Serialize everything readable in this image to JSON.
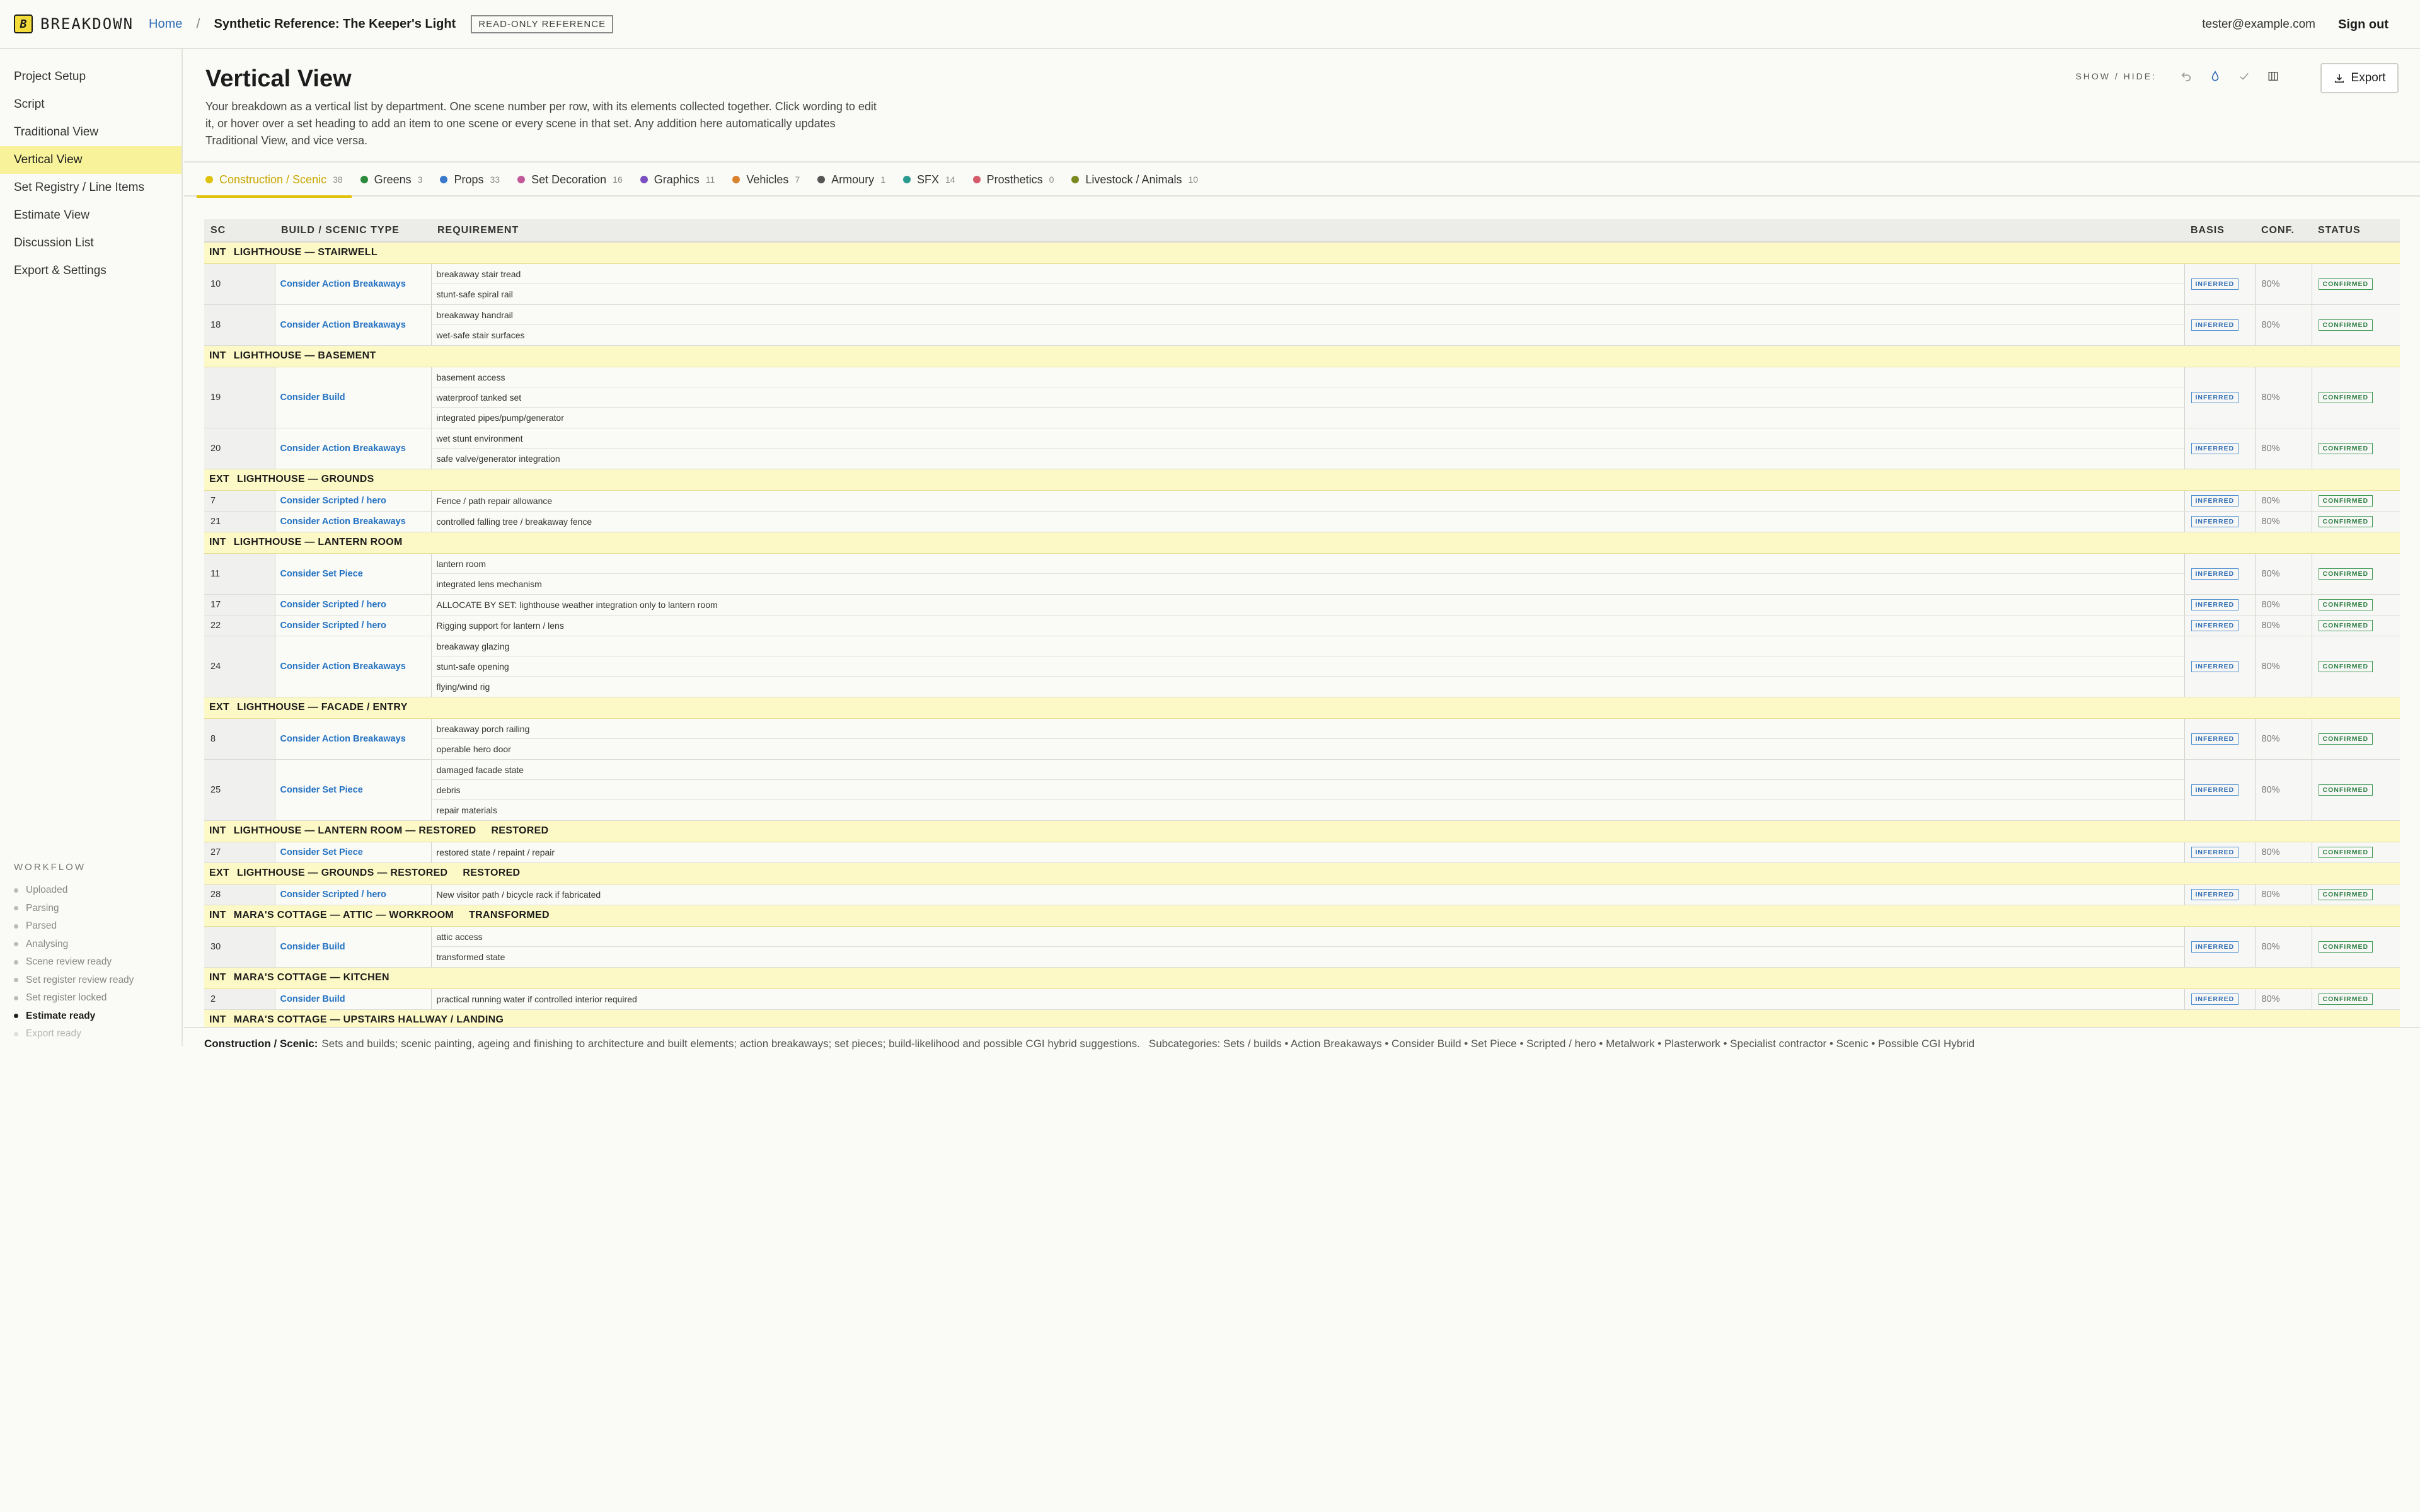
{
  "topbar": {
    "logo_mark": "B",
    "logo_text": "BREAKDOWN",
    "home": "Home",
    "separator": "/",
    "project_title": "Synthetic Reference: The Keeper's Light",
    "badge": "READ-ONLY REFERENCE",
    "user_email": "tester@example.com",
    "signout": "Sign out"
  },
  "sidebar": {
    "items": [
      {
        "label": "Project Setup"
      },
      {
        "label": "Script"
      },
      {
        "label": "Traditional View"
      },
      {
        "label": "Vertical View",
        "active": true
      },
      {
        "label": "Set Registry / Line Items"
      },
      {
        "label": "Estimate View"
      },
      {
        "label": "Discussion List"
      },
      {
        "label": "Export & Settings"
      }
    ],
    "workflow_title": "WORKFLOW",
    "workflow": [
      {
        "label": "Uploaded",
        "state": "done"
      },
      {
        "label": "Parsing",
        "state": "done"
      },
      {
        "label": "Parsed",
        "state": "done"
      },
      {
        "label": "Analysing",
        "state": "done"
      },
      {
        "label": "Scene review ready",
        "state": "done"
      },
      {
        "label": "Set register review ready",
        "state": "done"
      },
      {
        "label": "Set register locked",
        "state": "done"
      },
      {
        "label": "Estimate ready",
        "state": "current"
      },
      {
        "label": "Export ready",
        "state": "future"
      }
    ]
  },
  "page": {
    "title": "Vertical View",
    "description": "Your breakdown as a vertical list by department. One scene number per row, with its elements collected together. Click wording to edit it, or hover over a set heading to add an item to one scene or every scene in that set. Any addition here automatically updates Traditional View, and vice versa.",
    "show_hide_label": "SHOW / HIDE:",
    "export_label": "Export"
  },
  "tabs": [
    {
      "label": "Construction / Scenic",
      "count": "38",
      "color": "#e0c20b",
      "active": true
    },
    {
      "label": "Greens",
      "count": "3",
      "color": "#2e8b3e"
    },
    {
      "label": "Props",
      "count": "33",
      "color": "#3a78c9"
    },
    {
      "label": "Set Decoration",
      "count": "16",
      "color": "#c25a9a"
    },
    {
      "label": "Graphics",
      "count": "11",
      "color": "#7a4fc0"
    },
    {
      "label": "Vehicles",
      "count": "7",
      "color": "#d9822b"
    },
    {
      "label": "Armoury",
      "count": "1",
      "color": "#555555"
    },
    {
      "label": "SFX",
      "count": "14",
      "color": "#2a9a8f"
    },
    {
      "label": "Prosthetics",
      "count": "0",
      "color": "#d45b6a"
    },
    {
      "label": "Livestock / Animals",
      "count": "10",
      "color": "#7a8a1f"
    }
  ],
  "table": {
    "headers": {
      "sc": "SC",
      "type": "BUILD / SCENIC TYPE",
      "req": "REQUIREMENT",
      "basis": "BASIS",
      "conf": "CONF.",
      "status": "STATUS"
    },
    "basis_label": "INFERRED",
    "status_label": "CONFIRMED",
    "groups": [
      {
        "ie": "INT",
        "name": "LIGHTHOUSE — STAIRWELL",
        "tag": "",
        "scenes": [
          {
            "sc": "10",
            "type": "Consider Action Breakaways",
            "reqs": [
              "breakaway stair tread",
              "stunt-safe spiral rail"
            ],
            "conf": "80%"
          },
          {
            "sc": "18",
            "type": "Consider Action Breakaways",
            "reqs": [
              "breakaway handrail",
              "wet-safe stair surfaces"
            ],
            "conf": "80%"
          }
        ]
      },
      {
        "ie": "INT",
        "name": "LIGHTHOUSE — BASEMENT",
        "tag": "",
        "scenes": [
          {
            "sc": "19",
            "type": "Consider Build",
            "reqs": [
              "basement access",
              "waterproof tanked set",
              "integrated pipes/pump/generator"
            ],
            "conf": "80%"
          },
          {
            "sc": "20",
            "type": "Consider Action Breakaways",
            "reqs": [
              "wet stunt environment",
              "safe valve/generator integration"
            ],
            "conf": "80%"
          }
        ]
      },
      {
        "ie": "EXT",
        "name": "LIGHTHOUSE — GROUNDS",
        "tag": "",
        "scenes": [
          {
            "sc": "7",
            "type": "Consider Scripted / hero",
            "reqs": [
              "Fence / path repair allowance"
            ],
            "conf": "80%"
          },
          {
            "sc": "21",
            "type": "Consider Action Breakaways",
            "reqs": [
              "controlled falling tree / breakaway fence"
            ],
            "conf": "80%"
          }
        ]
      },
      {
        "ie": "INT",
        "name": "LIGHTHOUSE — LANTERN ROOM",
        "tag": "",
        "scenes": [
          {
            "sc": "11",
            "type": "Consider Set Piece",
            "reqs": [
              "lantern room",
              "integrated lens mechanism"
            ],
            "conf": "80%"
          },
          {
            "sc": "17",
            "type": "Consider Scripted / hero",
            "reqs": [
              "ALLOCATE BY SET: lighthouse weather integration only to lantern room"
            ],
            "conf": "80%"
          },
          {
            "sc": "22",
            "type": "Consider Scripted / hero",
            "reqs": [
              "Rigging support for lantern / lens"
            ],
            "conf": "80%"
          },
          {
            "sc": "24",
            "type": "Consider Action Breakaways",
            "reqs": [
              "breakaway glazing",
              "stunt-safe opening",
              "flying/wind rig"
            ],
            "conf": "80%"
          }
        ]
      },
      {
        "ie": "EXT",
        "name": "LIGHTHOUSE — FACADE / ENTRY",
        "tag": "",
        "scenes": [
          {
            "sc": "8",
            "type": "Consider Action Breakaways",
            "reqs": [
              "breakaway porch railing",
              "operable hero door"
            ],
            "conf": "80%"
          },
          {
            "sc": "25",
            "type": "Consider Set Piece",
            "reqs": [
              "damaged facade state",
              "debris",
              "repair materials"
            ],
            "conf": "80%"
          }
        ]
      },
      {
        "ie": "INT",
        "name": "LIGHTHOUSE — LANTERN ROOM — RESTORED",
        "tag": "RESTORED",
        "scenes": [
          {
            "sc": "27",
            "type": "Consider Set Piece",
            "reqs": [
              "restored state / repaint / repair"
            ],
            "conf": "80%"
          }
        ]
      },
      {
        "ie": "EXT",
        "name": "LIGHTHOUSE — GROUNDS — RESTORED",
        "tag": "RESTORED",
        "scenes": [
          {
            "sc": "28",
            "type": "Consider Scripted / hero",
            "reqs": [
              "New visitor path / bicycle rack if fabricated"
            ],
            "conf": "80%"
          }
        ]
      },
      {
        "ie": "INT",
        "name": "MARA'S COTTAGE — ATTIC — WORKROOM",
        "tag": "TRANSFORMED",
        "scenes": [
          {
            "sc": "30",
            "type": "Consider Build",
            "reqs": [
              "attic access",
              "transformed state"
            ],
            "conf": "80%"
          }
        ]
      },
      {
        "ie": "INT",
        "name": "MARA'S COTTAGE — KITCHEN",
        "tag": "",
        "scenes": [
          {
            "sc": "2",
            "type": "Consider Build",
            "reqs": [
              "practical running water if controlled interior required"
            ],
            "conf": "80%"
          }
        ]
      },
      {
        "ie": "INT",
        "name": "MARA'S COTTAGE — UPSTAIRS HALLWAY / LANDING",
        "tag": "",
        "scenes": []
      }
    ]
  },
  "footer": {
    "dept": "Construction / Scenic:",
    "desc": "Sets and builds; scenic painting, ageing and finishing to architecture and built elements; action breakaways; set pieces; build-likelihood and possible CGI hybrid suggestions.",
    "subcategories": "Subcategories: Sets / builds • Action Breakaways • Consider Build • Set Piece • Scripted / hero • Metalwork • Plasterwork • Specialist contractor • Scenic • Possible CGI Hybrid"
  }
}
